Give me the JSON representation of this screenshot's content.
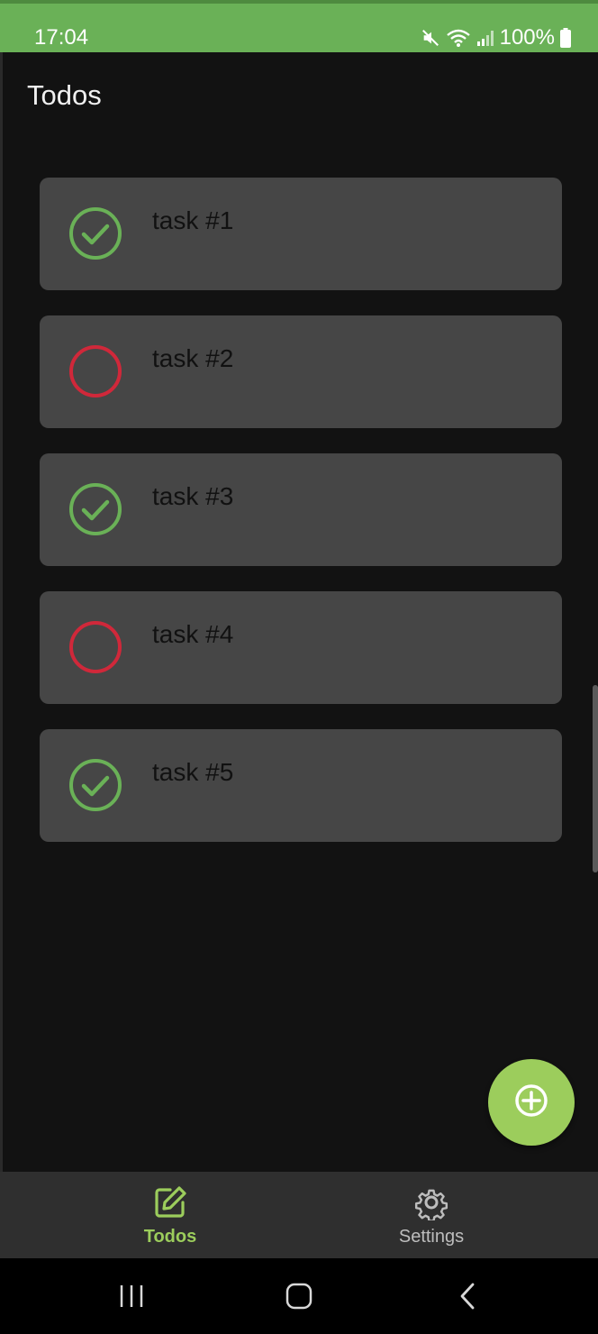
{
  "status_bar": {
    "time": "17:04",
    "battery": "100%",
    "icons": [
      "mute-icon",
      "wifi-icon",
      "signal-icon",
      "battery-icon"
    ]
  },
  "app_bar": {
    "title": "Todos"
  },
  "todos": [
    {
      "label": "task #1",
      "done": true
    },
    {
      "label": "task #2",
      "done": false
    },
    {
      "label": "task #3",
      "done": true
    },
    {
      "label": "task #4",
      "done": false
    },
    {
      "label": "task #5",
      "done": true
    }
  ],
  "fab": {
    "icon": "add-circle-icon"
  },
  "bottom_nav": {
    "items": [
      {
        "label": "Todos",
        "icon": "edit-icon",
        "active": true
      },
      {
        "label": "Settings",
        "icon": "gear-icon",
        "active": false
      }
    ]
  },
  "system_nav": {
    "icons": [
      "recents-icon",
      "home-icon",
      "back-icon"
    ]
  },
  "colors": {
    "status_bar": "#6ab157",
    "accent": "#9ccd5c",
    "done": "#6ab157",
    "pending": "#d0283a",
    "card": "#464646",
    "background": "#121212"
  }
}
